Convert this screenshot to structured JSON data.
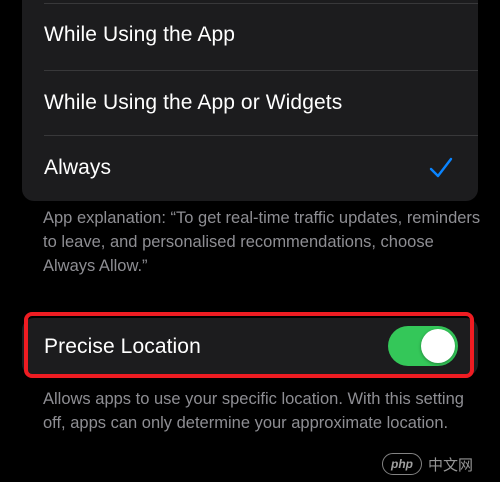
{
  "permission_options": [
    {
      "label": "While Using the App",
      "selected": false
    },
    {
      "label": "While Using the App or Widgets",
      "selected": false
    },
    {
      "label": "Always",
      "selected": true
    }
  ],
  "explanation": "App explanation: “To get real-time traffic updates, reminders to leave, and personalised recommendations, choose Always Allow.”",
  "precise_location": {
    "label": "Precise Location",
    "enabled": true,
    "description": "Allows apps to use your specific location. With this setting off, apps can only determine your approximate location."
  },
  "watermark": {
    "logo_text": "php",
    "text": "中文网"
  },
  "colors": {
    "background": "#000000",
    "group_bg": "#1c1c1e",
    "accent_blue": "#0a84ff",
    "toggle_green": "#34c759",
    "highlight_red": "#ee1c22",
    "secondary_text": "#8e8e93"
  }
}
